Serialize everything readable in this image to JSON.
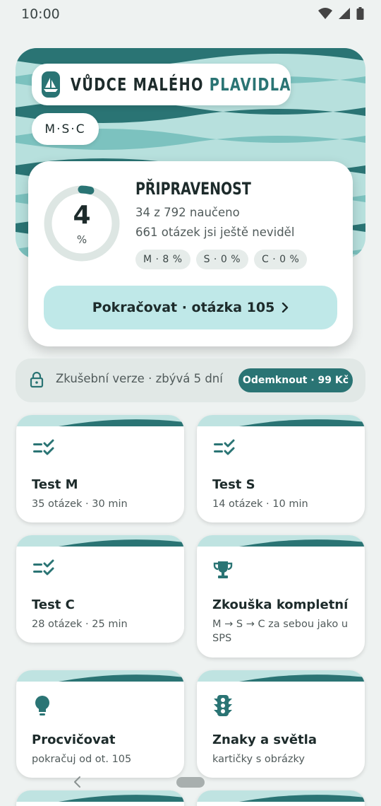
{
  "status_bar": {
    "time": "10:00"
  },
  "header": {
    "brand_main": "VŮDCE MALÉHO ",
    "brand_accent": "PLAVIDLA",
    "levels": "M·S·C"
  },
  "readiness": {
    "percent": "4",
    "unit": "%",
    "progress_fraction": 0.04,
    "title": "PŘIPRAVENOST",
    "learned": "34 z 792 naučeno",
    "unseen": "661 otázek jsi ještě neviděl",
    "chips": [
      "M · 8 %",
      "S · 0 %",
      "C · 0 %"
    ],
    "continue_label": "Pokračovat · otázka 105"
  },
  "trial": {
    "text": "Zkušební verze · zbývá 5 dní",
    "unlock_label": "Odemknout · 99 Kč"
  },
  "tiles": [
    {
      "icon": "checklist-icon",
      "title": "Test M",
      "subtitle": "35 otázek · 30 min"
    },
    {
      "icon": "checklist-icon",
      "title": "Test S",
      "subtitle": "14 otázek · 10 min"
    },
    {
      "icon": "checklist-icon",
      "title": "Test C",
      "subtitle": "28 otázek · 25 min"
    },
    {
      "icon": "trophy-icon",
      "title": "Zkouška kompletní",
      "subtitle": "M → S → C za sebou jako u SPS"
    },
    {
      "icon": "lightbulb-icon",
      "title": "Procvičovat",
      "subtitle": "pokračuj od ot. 105"
    },
    {
      "icon": "traffic-light-icon",
      "title": "Znaky a světla",
      "subtitle": "kartičky s obrázky"
    }
  ],
  "colors": {
    "accent": "#2a7474",
    "hero_background": "#b7e0dd",
    "continue_background": "#bfe8e8",
    "page_background": "#eef2f1"
  }
}
